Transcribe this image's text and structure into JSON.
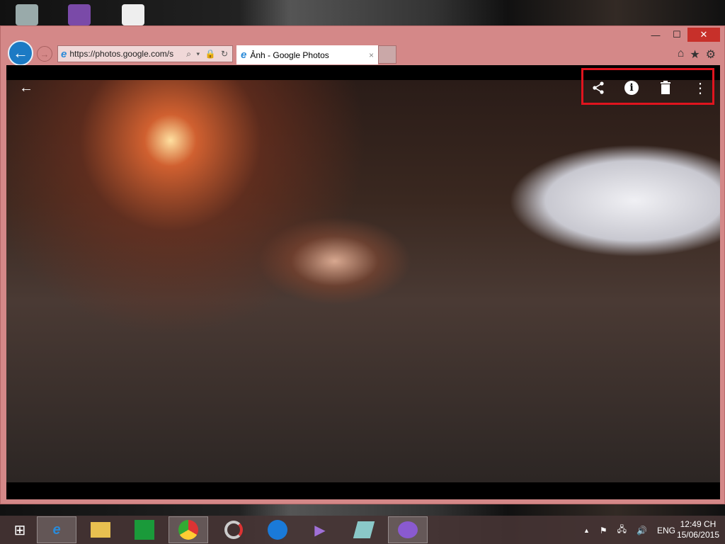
{
  "window": {
    "minimize": "—",
    "maximize": "☐",
    "close": "✕"
  },
  "browser": {
    "url": "https://photos.google.com/s",
    "tab_title": "Ảnh - Google Photos",
    "tab_close": "×",
    "address_tools": "⌕ ▾ 🔒 ↻",
    "home": "⌂",
    "favorites": "★",
    "settings": "⚙"
  },
  "viewer": {
    "back": "←",
    "share": "share",
    "info": "i",
    "delete": "🗑",
    "more": "⋮"
  },
  "taskbar": {
    "start": "⊞",
    "apps": [
      "Internet Explorer",
      "File Explorer",
      "Store",
      "Chrome",
      "App",
      "TeamViewer",
      "Visual Studio",
      "App",
      "Yahoo Messenger"
    ]
  },
  "tray": {
    "chevron": "▲",
    "language": "ENG",
    "time": "12:49 CH",
    "date": "15/06/2015"
  }
}
